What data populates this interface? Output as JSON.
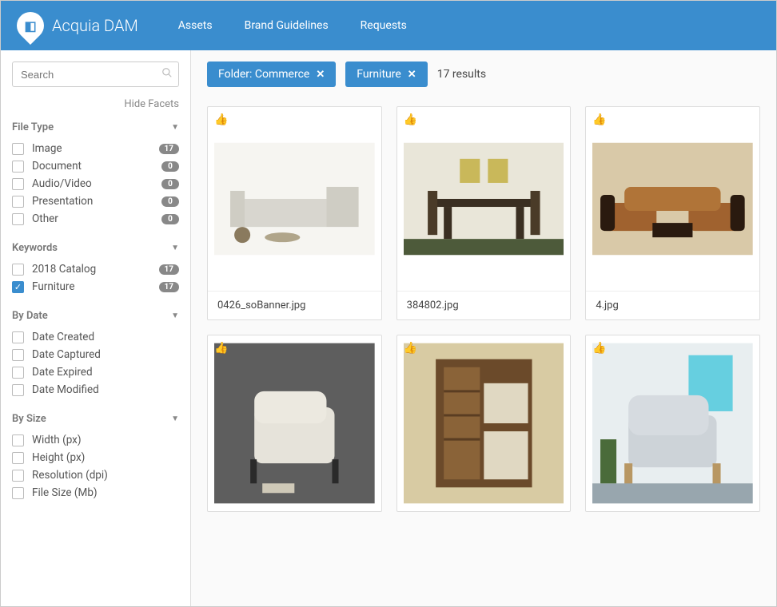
{
  "header": {
    "brand": "Acquia DAM",
    "nav": [
      {
        "label": "Assets"
      },
      {
        "label": "Brand Guidelines"
      },
      {
        "label": "Requests"
      }
    ]
  },
  "sidebar": {
    "search_placeholder": "Search",
    "hide_facets_label": "Hide Facets",
    "sections": [
      {
        "title": "File Type",
        "collapsable": true,
        "items": [
          {
            "label": "Image",
            "count": 17,
            "checked": false
          },
          {
            "label": "Document",
            "count": 0,
            "checked": false
          },
          {
            "label": "Audio/Video",
            "count": 0,
            "checked": false
          },
          {
            "label": "Presentation",
            "count": 0,
            "checked": false
          },
          {
            "label": "Other",
            "count": 0,
            "checked": false
          }
        ]
      },
      {
        "title": "Keywords",
        "collapsable": true,
        "items": [
          {
            "label": "2018 Catalog",
            "count": 17,
            "checked": false
          },
          {
            "label": "Furniture",
            "count": 17,
            "checked": true
          }
        ]
      },
      {
        "title": "By Date",
        "collapsable": true,
        "items": [
          {
            "label": "Date Created",
            "checked": false
          },
          {
            "label": "Date Captured",
            "checked": false
          },
          {
            "label": "Date Expired",
            "checked": false
          },
          {
            "label": "Date Modified",
            "checked": false
          }
        ]
      },
      {
        "title": "By Size",
        "collapsable": true,
        "items": [
          {
            "label": "Width (px)",
            "checked": false
          },
          {
            "label": "Height (px)",
            "checked": false
          },
          {
            "label": "Resolution (dpi)",
            "checked": false
          },
          {
            "label": "File Size (Mb)",
            "checked": false
          }
        ]
      }
    ]
  },
  "content": {
    "filter_chips": [
      {
        "label": "Folder: Commerce"
      },
      {
        "label": "Furniture"
      }
    ],
    "results_text": "17 results",
    "assets": [
      {
        "filename": "0426_soBanner.jpg",
        "show_label": true
      },
      {
        "filename": "384802.jpg",
        "show_label": true
      },
      {
        "filename": "4.jpg",
        "show_label": true
      },
      {
        "filename": "",
        "show_label": false
      },
      {
        "filename": "",
        "show_label": false
      },
      {
        "filename": "",
        "show_label": false
      }
    ]
  }
}
